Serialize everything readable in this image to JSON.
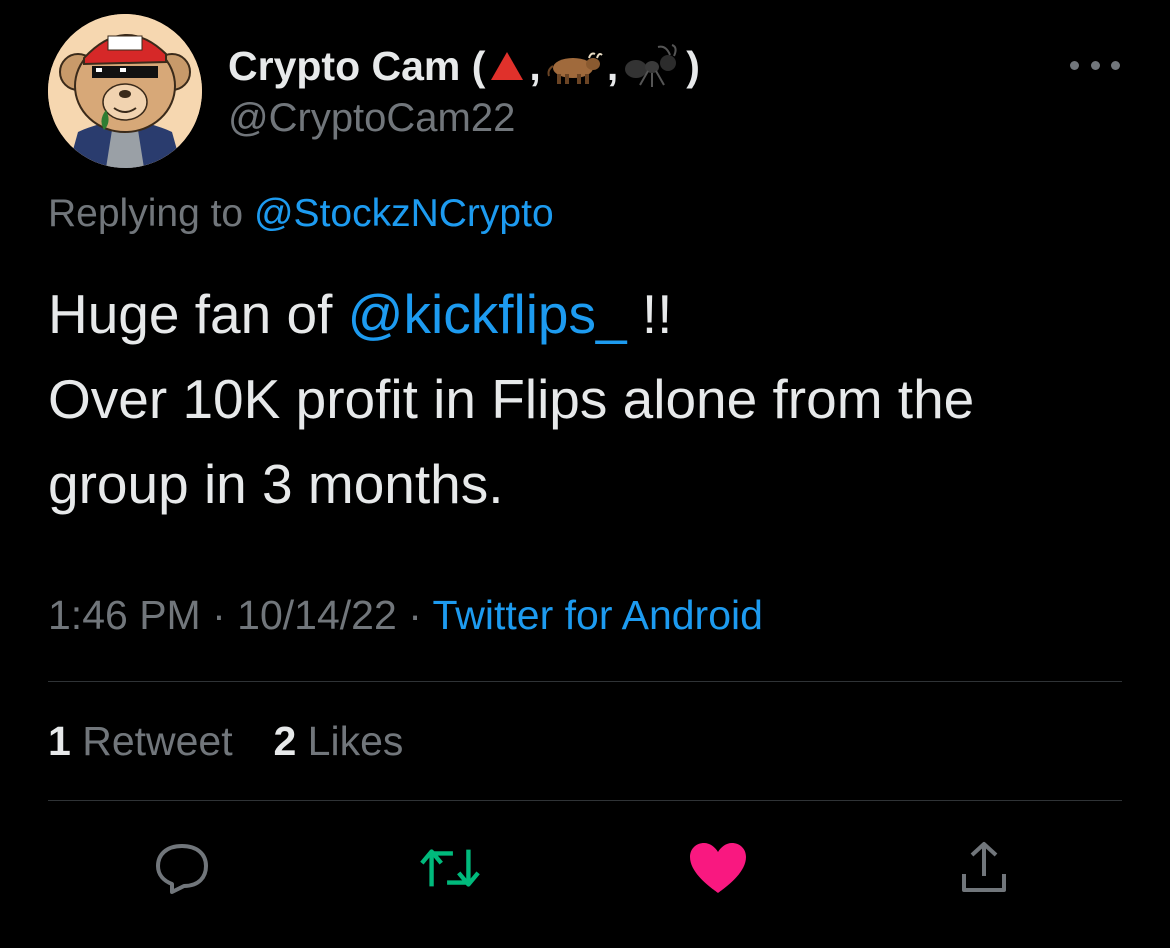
{
  "author": {
    "name": "Crypto Cam (",
    "name_sep_1": ",",
    "name_sep_2": ",",
    "name_close": ")",
    "name_emojis": [
      "red-triangle-icon",
      "ox-icon",
      "ant-icon"
    ],
    "handle": "@CryptoCam22",
    "avatar": "cartoon-bear-avatar"
  },
  "reply": {
    "prefix": "Replying to",
    "mention": "@StockzNCrypto"
  },
  "tweet": {
    "line1_before": "Huge fan of",
    "line1_mention": "@kickflips_",
    "line1_after": "!!",
    "line2": "Over 10K profit in Flips alone from the",
    "line3": "group in 3 months."
  },
  "meta": {
    "time": "1:46 PM",
    "sep": "·",
    "date": "10/14/22",
    "source": "Twitter for Android"
  },
  "stats": {
    "retweets_count": "1",
    "retweets_label": "Retweet",
    "likes_count": "2",
    "likes_label": "Likes"
  },
  "actions": [
    "reply-icon",
    "retweet-icon",
    "like-icon",
    "share-icon"
  ],
  "colors": {
    "background": "#000000",
    "text": "#e7e9ea",
    "secondary": "#71767b",
    "link": "#1d9bf0",
    "retweet_active": "#00ba7c",
    "like_active": "#f91880",
    "divider": "#2f3336"
  }
}
